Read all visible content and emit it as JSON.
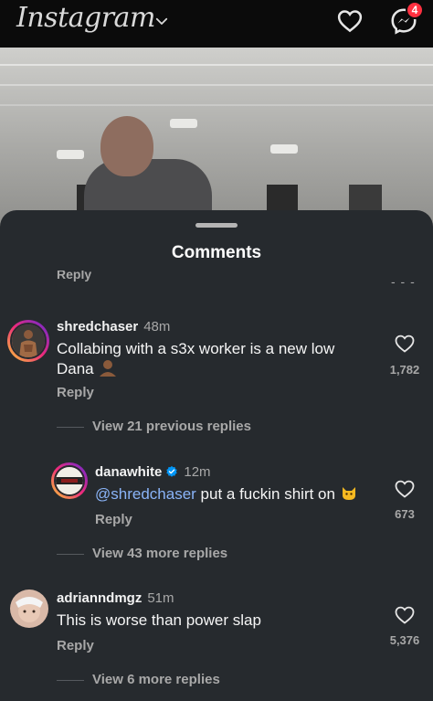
{
  "app": {
    "name": "Instagram",
    "notification_count": "4"
  },
  "sheet": {
    "title": "Comments",
    "clipped_reply_label": "Reply",
    "clipped_more": "- - -"
  },
  "comments": [
    {
      "username": "shredchaser",
      "time": "48m",
      "text_line1": "Collabing with a s3x worker is a new low",
      "text_line2": "Dana",
      "reply_label": "Reply",
      "likes": "1,782",
      "view_replies": "View 21 previous replies"
    },
    {
      "username": "danawhite",
      "verified": true,
      "time": "12m",
      "mention": "@shredchaser",
      "text": "put a fuckin shirt on",
      "reply_label": "Reply",
      "likes": "673",
      "view_replies": "View 43 more replies"
    },
    {
      "username": "adrianndmgz",
      "time": "51m",
      "text": "This is worse than power slap",
      "reply_label": "Reply",
      "likes": "5,376",
      "view_replies": "View 6 more replies"
    }
  ],
  "icons": {
    "logo_chevron": "chevron-down-icon",
    "activity": "heart-icon",
    "messages": "messenger-icon",
    "like": "heart-outline-icon",
    "verified": "verified-badge-icon"
  },
  "colors": {
    "sheet_bg": "#262a2e",
    "badge": "#ff3040",
    "mention": "#8ab4f8",
    "verified": "#0095f6"
  }
}
